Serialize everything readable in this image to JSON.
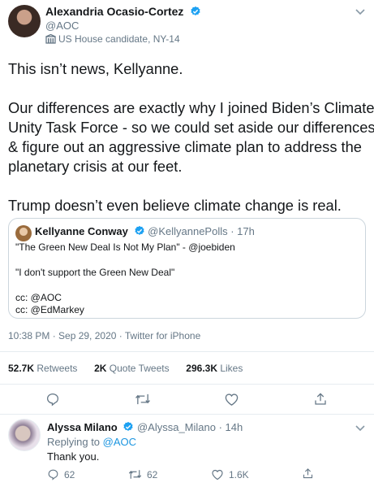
{
  "tweet": {
    "author": {
      "name": "Alexandria Ocasio-Cortez",
      "handle": "@AOC",
      "label": "US House candidate, NY-14"
    },
    "text_lines": [
      "This isn’t news, Kellyanne.",
      "",
      "Our differences are exactly why I joined Biden’s Climate",
      "Unity Task Force - so we could set aside our differences",
      "& figure out an aggressive climate plan to address the",
      "planetary crisis at our feet.",
      "",
      "Trump doesn’t even believe climate change is real."
    ],
    "timestamp": "10:38 PM · Sep 29, 2020 · Twitter for iPhone",
    "stats": {
      "retweets_count": "52.7K",
      "retweets_label": "Retweets",
      "quotes_count": "2K",
      "quotes_label": "Quote Tweets",
      "likes_count": "296.3K",
      "likes_label": "Likes"
    }
  },
  "quoted": {
    "name": "Kellyanne Conway",
    "meta": "@KellyannePolls · 17h",
    "lines": [
      "\"The Green New Deal Is Not My Plan\" - @joebiden",
      "\"I don't support the Green New Deal\"",
      "cc: @AOC",
      "cc: @EdMarkey"
    ]
  },
  "reply": {
    "name": "Alyssa Milano",
    "meta": "@Alyssa_Milano · 14h",
    "replying_prefix": "Replying to",
    "replying_handle": "@AOC",
    "text": "Thank you.",
    "reply_count": "62",
    "retweet_count": "62",
    "like_count": "1.6K"
  },
  "icons": [
    "verified-badge-icon",
    "building-icon",
    "chevron-down-icon",
    "reply-icon",
    "retweet-icon",
    "like-icon",
    "share-icon"
  ],
  "colors": {
    "link": "#1b95e0",
    "verified": "#1da1f2",
    "muted": "#657786"
  }
}
